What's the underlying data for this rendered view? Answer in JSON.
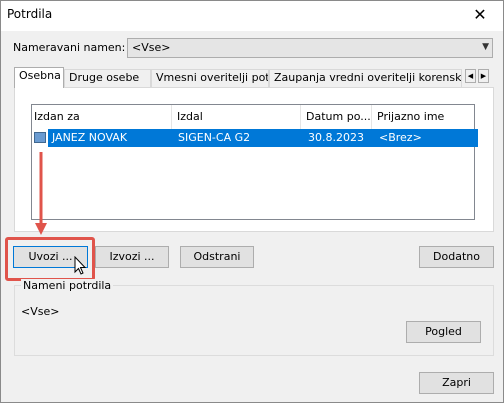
{
  "window": {
    "title": "Potrdila",
    "close_glyph": "✕"
  },
  "purpose": {
    "label": "Nameravani namen:",
    "value": "<Vse>"
  },
  "tabs": [
    {
      "label": "Osebna",
      "active": true
    },
    {
      "label": "Druge osebe",
      "active": false
    },
    {
      "label": "Vmesni overitelji potrdil",
      "active": false
    },
    {
      "label": "Zaupanja vredni overitelji korenskih potrd",
      "active": false
    }
  ],
  "list": {
    "columns": [
      "Izdan za",
      "Izdal",
      "Datum po...",
      "Prijazno ime"
    ],
    "rows": [
      {
        "issued_to": "JANEZ NOVAK",
        "issuer": "SIGEN-CA G2",
        "expires": "30.8.2023",
        "friendly_name": "<Brez>",
        "selected": true
      }
    ]
  },
  "buttons": {
    "import": "Uvozi ...",
    "export": "Izvozi ...",
    "remove": "Odstrani",
    "advanced": "Dodatno",
    "view": "Pogled",
    "close": "Zapri"
  },
  "purposes_group": {
    "title": "Nameni potrdila",
    "value": "<Vse>"
  },
  "annotation": {
    "color": "#e0544b"
  }
}
